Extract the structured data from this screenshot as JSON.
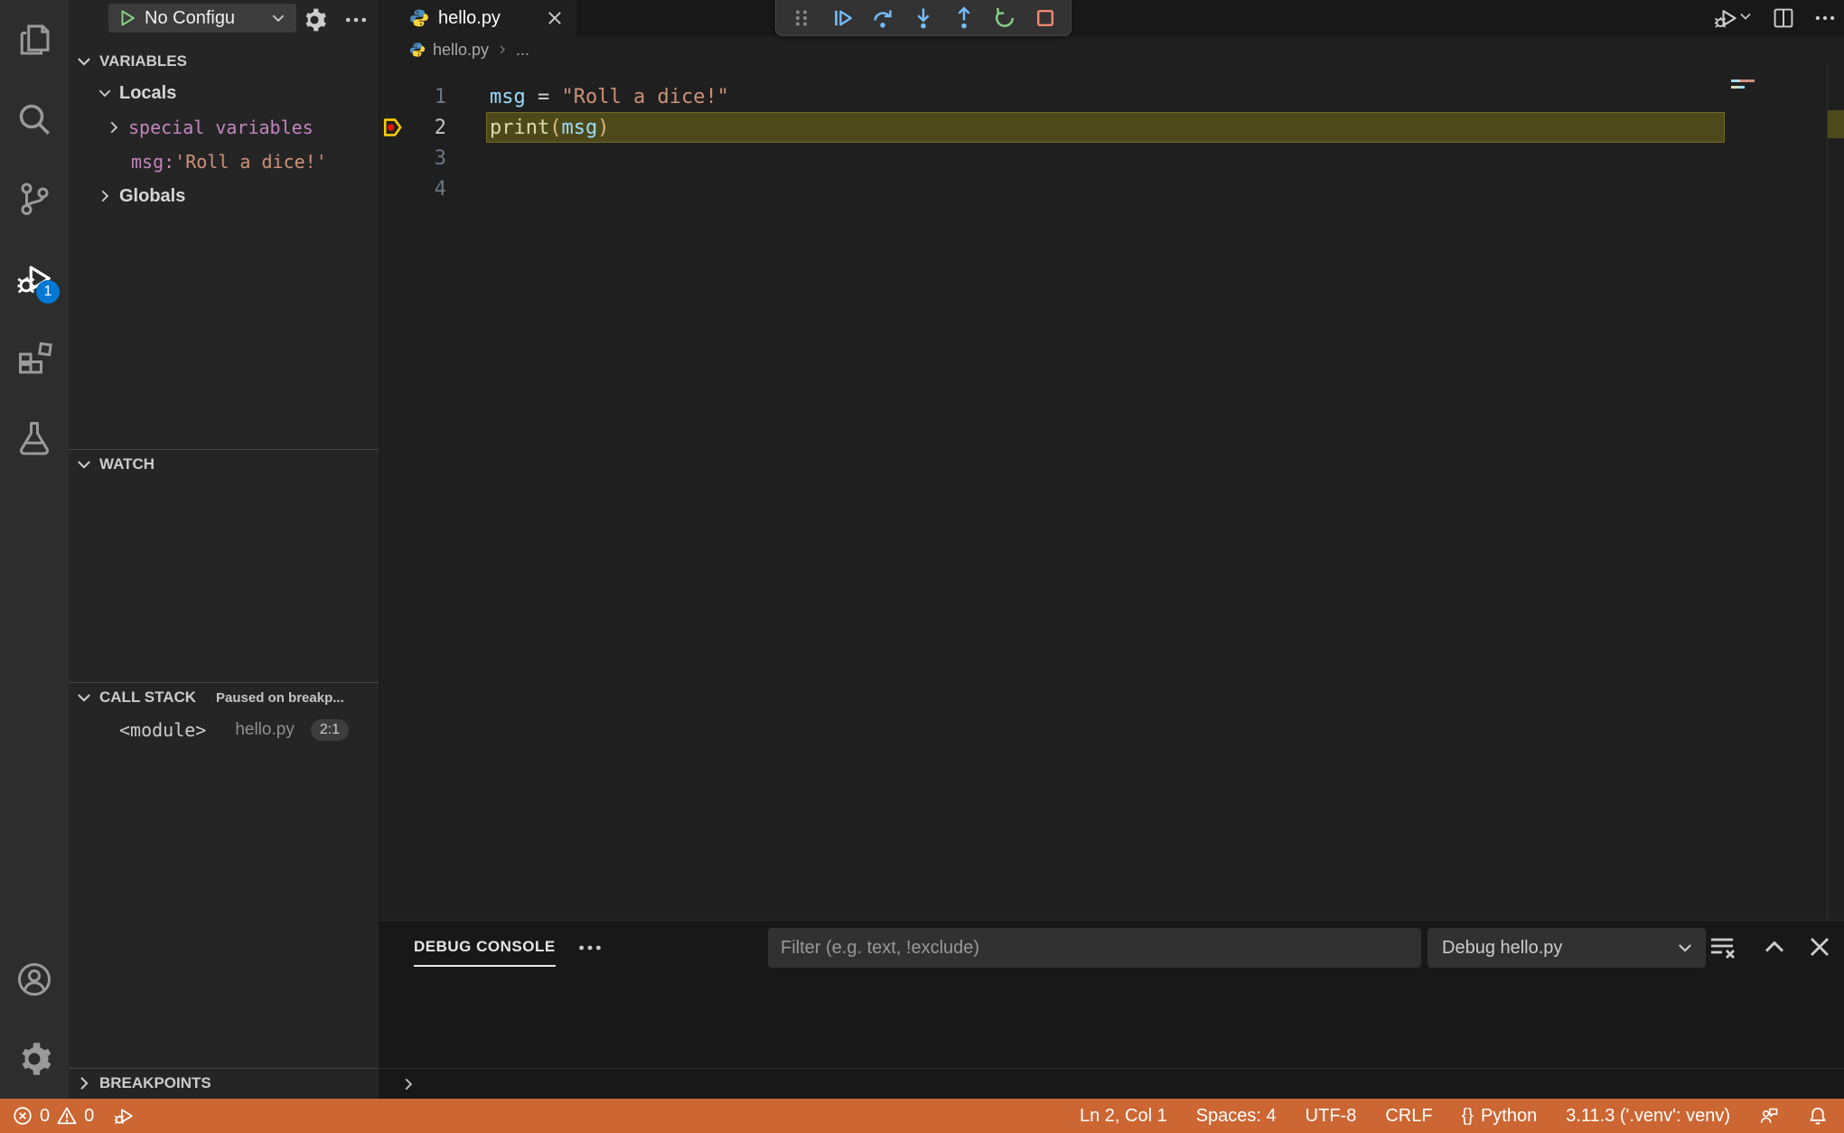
{
  "activity_bar": {
    "items": [
      "explorer",
      "search",
      "source-control",
      "run-and-debug",
      "extensions",
      "testing"
    ],
    "debug_badge": "1",
    "bottom_items": [
      "account",
      "settings"
    ]
  },
  "sidebar": {
    "toolbar": {
      "config_label": "No Configu",
      "icons": [
        "play",
        "chevron-down",
        "gear",
        "more-actions"
      ]
    },
    "variables": {
      "title": "VARIABLES",
      "locals_label": "Locals",
      "special_label": "special variables",
      "msg_name": "msg: ",
      "msg_value": "'Roll a dice!'",
      "globals_label": "Globals"
    },
    "watch": {
      "title": "WATCH"
    },
    "call_stack": {
      "title": "CALL STACK",
      "status": "Paused on breakp...",
      "frame": "<module>",
      "file": "hello.py",
      "position": "2:1"
    },
    "breakpoints": {
      "title": "BREAKPOINTS"
    }
  },
  "editor": {
    "tab": {
      "label": "hello.py"
    },
    "breadcrumb": {
      "file": "hello.py",
      "more": "..."
    },
    "debug_toolbar_icons": [
      "gripper",
      "continue",
      "step-over",
      "step-into",
      "step-out",
      "restart",
      "stop"
    ],
    "action_icons": [
      "run-or-debug",
      "split-editor",
      "more-actions"
    ],
    "code": {
      "lines": [
        {
          "num": "1",
          "tokens": [
            {
              "text": "msg"
            },
            {
              "text": " = "
            },
            {
              "text": "\"Roll a dice!\""
            }
          ]
        },
        {
          "num": "2",
          "current": true,
          "tokens": [
            {
              "text": "print"
            },
            {
              "text": "("
            },
            {
              "text": "msg"
            },
            {
              "text": ")"
            }
          ]
        },
        {
          "num": "3",
          "tokens": []
        },
        {
          "num": "4",
          "tokens": []
        }
      ]
    }
  },
  "panel": {
    "tab": "DEBUG CONSOLE",
    "filter_placeholder": "Filter (e.g. text, !exclude)",
    "session": "Debug hello.py",
    "icons": [
      "more-actions",
      "clear-console",
      "maximize-panel",
      "close-panel",
      "console-prompt-chevron"
    ]
  },
  "status_bar": {
    "errors": "0",
    "warnings": "0",
    "line_col": "Ln 2, Col 1",
    "indent": "Spaces: 4",
    "encoding": "UTF-8",
    "eol": "CRLF",
    "language_brackets": "{}",
    "language": "Python",
    "interpreter": "3.11.3 ('.venv': venv)",
    "icons": [
      "error",
      "warning",
      "debug",
      "feedback",
      "bell"
    ]
  },
  "colors": {
    "status_bar_debugging": "#CC6633",
    "badge": "#0078D4",
    "current_line_highlight": "#4D491A",
    "python_icon_blue": "#4B8BBE",
    "python_icon_yellow": "#FFD43B",
    "debug_blue": "#75BEFF",
    "debug_green": "#89D185",
    "debug_red": "#F48771"
  }
}
